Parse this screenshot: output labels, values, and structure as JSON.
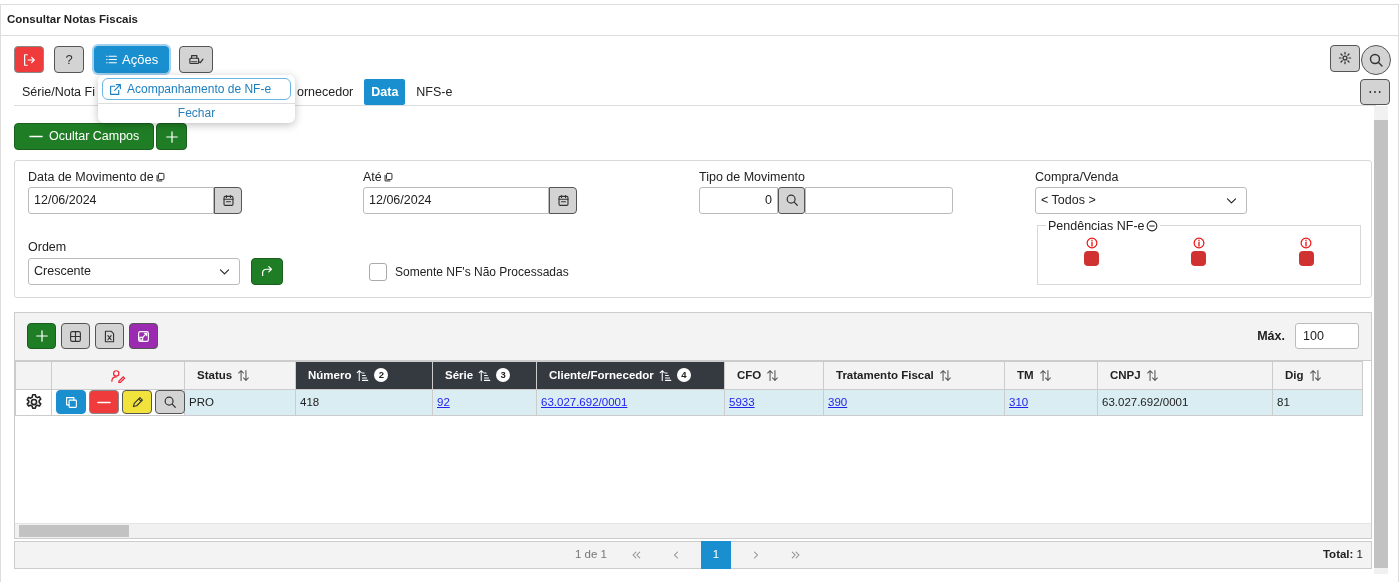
{
  "window": {
    "title": "Consultar Notas Fiscais"
  },
  "toolbar": {
    "buttons": [
      {
        "kind": "exit"
      },
      {
        "kind": "help",
        "label": "?"
      },
      {
        "kind": "actions",
        "label": "Ações",
        "expanded": true
      },
      {
        "kind": "print"
      }
    ],
    "right_buttons": [
      {
        "kind": "settings"
      },
      {
        "kind": "search"
      }
    ],
    "more": {
      "label": "⋯"
    }
  },
  "actions_menu": {
    "items": [
      {
        "label": "Acompanhamento de NF-e",
        "selected": true
      }
    ],
    "close": "Fechar"
  },
  "tabs": [
    {
      "label": "Série/Nota Fi",
      "selected": false
    },
    {
      "label": "ornecedor",
      "selected": false
    },
    {
      "label": "Data",
      "selected": true
    },
    {
      "label": "NFS-e",
      "selected": false
    }
  ],
  "toggle_fields": {
    "label": "Ocultar Campos"
  },
  "filters": {
    "date_from": {
      "label": "Data de Movimento de",
      "value": "12/06/2024"
    },
    "date_to": {
      "label": "Até",
      "value": "12/06/2024"
    },
    "movement_type": {
      "label": "Tipo de Movimento",
      "code": "0"
    },
    "purchase_sale": {
      "label": "Compra/Venda",
      "value": "< Todos >"
    },
    "order": {
      "label": "Ordem",
      "value": "Crescente"
    },
    "only_unprocessed": {
      "label": "Somente NF's Não Processadas",
      "checked": false
    },
    "pendencias": {
      "label": "Pendências NF-e",
      "items": [
        {
          "kind": "alert"
        },
        {
          "kind": "alert"
        },
        {
          "kind": "alert"
        }
      ]
    }
  },
  "grid": {
    "max_label": "Máx.",
    "max_value": "100",
    "columns": [
      {
        "kind": "select"
      },
      {
        "kind": "actions"
      },
      {
        "kind": "data",
        "label": "Status",
        "sorted": false
      },
      {
        "kind": "data",
        "label": "Número",
        "sorted": true,
        "order": "2"
      },
      {
        "kind": "data",
        "label": "Série",
        "sorted": true,
        "order": "3"
      },
      {
        "kind": "data",
        "label": "Cliente/Fornecedor",
        "sorted": true,
        "order": "4"
      },
      {
        "kind": "data",
        "label": "CFO",
        "sorted": false
      },
      {
        "kind": "data",
        "label": "Tratamento Fiscal",
        "sorted": false
      },
      {
        "kind": "data",
        "label": "TM",
        "sorted": false
      },
      {
        "kind": "data",
        "label": "CNPJ",
        "sorted": false
      },
      {
        "kind": "data",
        "label": "Dig",
        "sorted": false
      }
    ],
    "rows": [
      {
        "selected": true,
        "cells": [
          {
            "kind": "settings"
          },
          {
            "kind": "actions"
          },
          {
            "kind": "text",
            "text": "PRO"
          },
          {
            "kind": "text",
            "text": "418"
          },
          {
            "kind": "link",
            "text": "92"
          },
          {
            "kind": "link",
            "text": "63.027.692/0001"
          },
          {
            "kind": "link",
            "text": "5933"
          },
          {
            "kind": "link",
            "text": "390"
          },
          {
            "kind": "link",
            "text": "310"
          },
          {
            "kind": "text",
            "text": "63.027.692/0001"
          },
          {
            "kind": "text",
            "text": "81"
          }
        ]
      }
    ]
  },
  "pager": {
    "summary": "1 de 1",
    "pages": [
      {
        "label": "1",
        "selected": true
      }
    ],
    "total_label": "Total:",
    "total": "1"
  }
}
